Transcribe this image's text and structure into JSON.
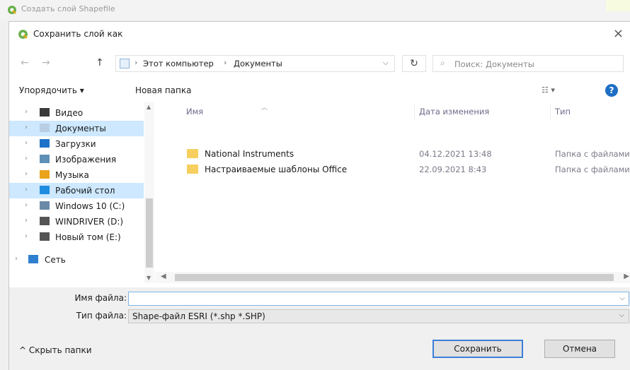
{
  "parent_window": {
    "title": "Создать слой Shapefile"
  },
  "dialog": {
    "title": "Сохранить слой как",
    "close_glyph": "×"
  },
  "nav": {
    "back_glyph": "←",
    "forward_glyph": "→",
    "up_glyph": "↑",
    "address": {
      "segments": [
        "Этот компьютер",
        "Документы"
      ],
      "separator": "›",
      "dropdown_glyph": "⌵"
    },
    "refresh_glyph": "↻",
    "search": {
      "icon_glyph": "⌕",
      "placeholder": "Поиск: Документы"
    }
  },
  "toolbar": {
    "organize_label": "Упорядочить ▾",
    "new_folder_label": "Новая папка",
    "view_glyph": "☷ ▾",
    "help_glyph": "?"
  },
  "sidebar": {
    "items": [
      {
        "label": "Видео",
        "icon": "video-icon",
        "color": "#3a3a3a",
        "selected": false
      },
      {
        "label": "Документы",
        "icon": "documents-icon",
        "color": "#b9cde3",
        "selected": true
      },
      {
        "label": "Загрузки",
        "icon": "download-icon",
        "color": "#1e73c8",
        "selected": false
      },
      {
        "label": "Изображения",
        "icon": "images-icon",
        "color": "#5e8fb6",
        "selected": false
      },
      {
        "label": "Музыка",
        "icon": "music-icon",
        "color": "#e9a31c",
        "selected": false
      },
      {
        "label": "Рабочий стол",
        "icon": "desktop-icon",
        "color": "#1f8de0",
        "selected": true
      },
      {
        "label": "Windows 10 (C:)",
        "icon": "drive-c-icon",
        "color": "#6a8aa8",
        "selected": false
      },
      {
        "label": "WINDRIVER (D:)",
        "icon": "drive-icon",
        "color": "#555555",
        "selected": false
      },
      {
        "label": "Новый том (E:)",
        "icon": "drive-icon",
        "color": "#555555",
        "selected": false
      },
      {
        "label": "Сеть",
        "icon": "network-icon",
        "color": "#2f7fd0",
        "selected": false
      }
    ],
    "chevron_glyph": "›"
  },
  "file_list": {
    "columns": [
      "Имя",
      "Дата изменения",
      "Тип"
    ],
    "rows": [
      {
        "name": "National Instruments",
        "date": "04.12.2021 13:48",
        "type": "Папка с файлами"
      },
      {
        "name": "Настраиваемые шаблоны Office",
        "date": "22.09.2021 8:43",
        "type": "Папка с файлами"
      }
    ],
    "folder_color": "#f6cf5e"
  },
  "form": {
    "filename_label": "Имя файла:",
    "filename_value": "",
    "filetype_label": "Тип файла:",
    "filetype_value": "Shape-файл ESRI (*.shp *.SHP)"
  },
  "footer": {
    "hide_folders_label": "^ Скрыть папки",
    "save_label": "Сохранить",
    "cancel_label": "Отмена"
  },
  "colors": {
    "accent": "#3c7fd8",
    "qgis_green": "#6ab04c",
    "selection": "#cde8ff"
  }
}
